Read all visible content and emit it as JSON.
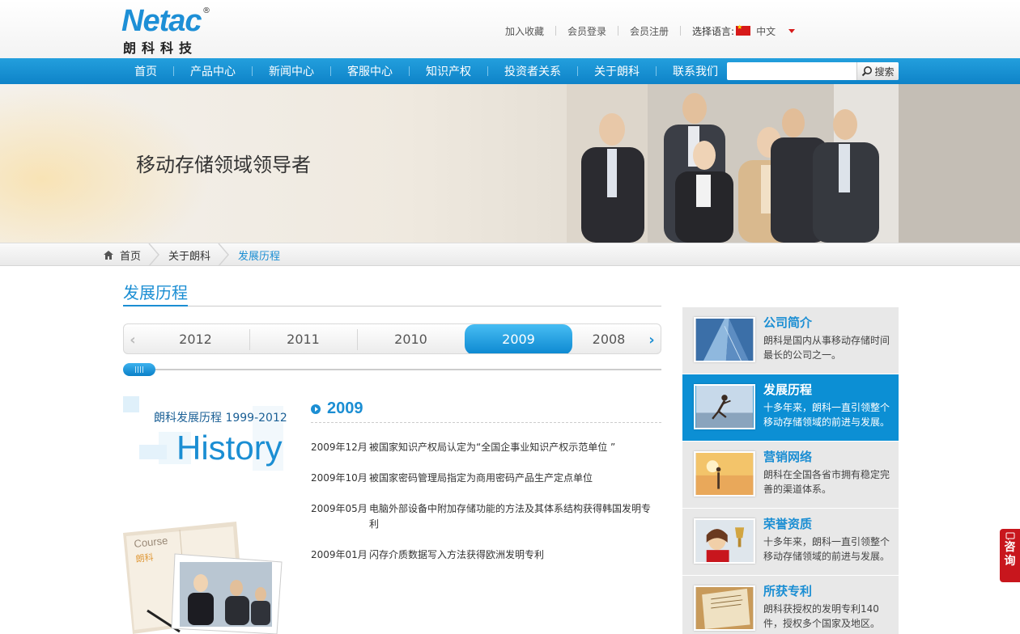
{
  "logo": {
    "word": "Netac",
    "reg": "®",
    "cn": "朗科科技"
  },
  "toplinks": {
    "favorite": "加入收藏",
    "login": "会员登录",
    "register": "会员注册",
    "lang_label": "选择语言:",
    "lang_value": "中文"
  },
  "nav": {
    "items": [
      "首页",
      "产品中心",
      "新闻中心",
      "客服中心",
      "知识产权",
      "投资者关系",
      "关于朗科",
      "联系我们"
    ],
    "search_placeholder": "",
    "search_button": "搜索"
  },
  "banner": {
    "title": "移动存储领域领导者"
  },
  "breadcrumb": {
    "home": "首页",
    "parent": "关于朗科",
    "current": "发展历程"
  },
  "section": {
    "title": "发展历程"
  },
  "years": {
    "items": [
      "2012",
      "2011",
      "2010",
      "2009",
      "2008"
    ],
    "active": "2009"
  },
  "history": {
    "small": "朗科发展历程 1999-2012",
    "big": "History"
  },
  "book": {
    "course": "Course",
    "cn": "朗科"
  },
  "timeline": {
    "year": "2009",
    "events": [
      {
        "date": "2009年12月",
        "desc": "被国家知识产权局认定为“全国企事业知识产权示范单位 ”"
      },
      {
        "date": "2009年10月",
        "desc": "被国家密码管理局指定为商用密码产品生产定点单位"
      },
      {
        "date": "2009年05月",
        "desc": "电脑外部设备中附加存储功能的方法及其体系结构获得韩国发明专利"
      },
      {
        "date": "2009年01月",
        "desc": "闪存介质数据写入方法获得欧洲发明专利"
      }
    ]
  },
  "sidebar": {
    "items": [
      {
        "title": "公司简介",
        "desc": "朗科是国内从事移动存储时间最长的公司之一。",
        "active": false
      },
      {
        "title": "发展历程",
        "desc": "十多年来，朗科一直引领整个移动存储领域的前进与发展。",
        "active": true
      },
      {
        "title": "营销网络",
        "desc": "朗科在全国各省市拥有稳定完善的渠道体系。",
        "active": false
      },
      {
        "title": "荣誉资质",
        "desc": "十多年来，朗科一直引领整个移动存储领域的前进与发展。",
        "active": false
      },
      {
        "title": "所获专利",
        "desc": "朗科获授权的发明专利140件，授权多个国家及地区。",
        "active": false
      }
    ]
  },
  "consult": {
    "c1": "咨",
    "c2": "询"
  },
  "colors": {
    "brand_blue": "#1b8ed3",
    "nav_blue": "#0e83c8",
    "consult_red": "#c8161d"
  }
}
